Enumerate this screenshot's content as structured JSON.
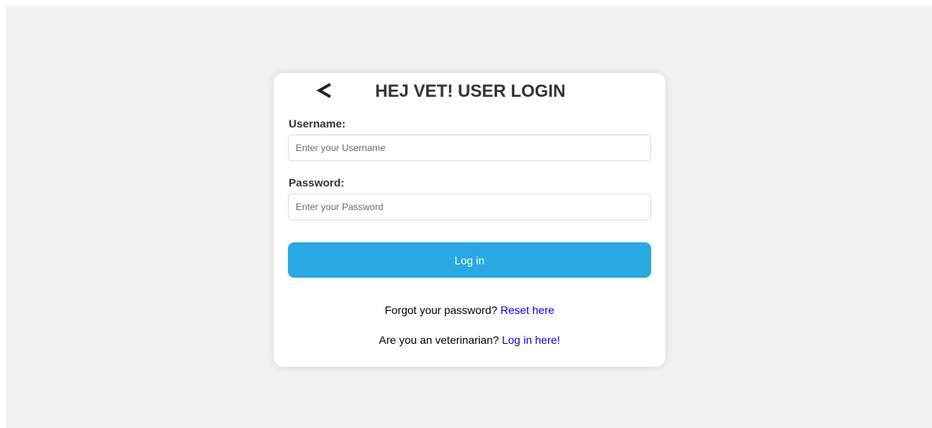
{
  "card": {
    "title": "HEJ VET! USER LOGIN",
    "back_icon": "chevron-left-icon"
  },
  "form": {
    "username_label": "Username:",
    "username_placeholder": "Enter your Username",
    "username_value": "",
    "password_label": "Password:",
    "password_placeholder": "Enter your Password",
    "password_value": "",
    "login_label": "Log in"
  },
  "links": {
    "forgot_text": "Forgot your password?",
    "forgot_link": "Reset here",
    "vet_text": "Are you an veterinarian?",
    "vet_link": "Log in here!"
  },
  "colors": {
    "background": "#f2f2f2",
    "card": "#ffffff",
    "accent": "#29a9e1",
    "link": "#0000ee"
  }
}
